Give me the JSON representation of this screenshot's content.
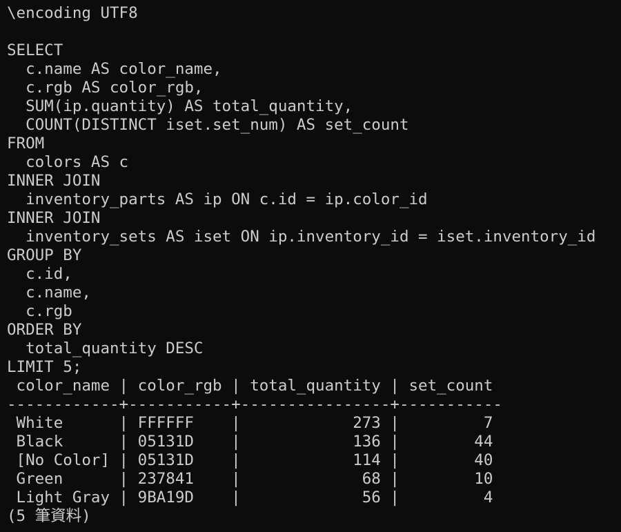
{
  "terminal": {
    "lines": [
      "\\encoding UTF8",
      "",
      "SELECT",
      "  c.name AS color_name,",
      "  c.rgb AS color_rgb,",
      "  SUM(ip.quantity) AS total_quantity,",
      "  COUNT(DISTINCT iset.set_num) AS set_count",
      "FROM",
      "  colors AS c",
      "INNER JOIN",
      "  inventory_parts AS ip ON c.id = ip.color_id",
      "INNER JOIN",
      "  inventory_sets AS iset ON ip.inventory_id = iset.inventory_id",
      "GROUP BY",
      "  c.id,",
      "  c.name,",
      "  c.rgb",
      "ORDER BY",
      "  total_quantity DESC",
      "LIMIT 5;",
      " color_name | color_rgb | total_quantity | set_count",
      "------------+-----------+----------------+-----------",
      " White      | FFFFFF    |            273 |         7",
      " Black      | 05131D    |            136 |        44",
      " [No Color] | 05131D    |            114 |        40",
      " Green      | 237841    |             68 |        10",
      " Light Gray | 9BA19D    |             56 |         4",
      "(5 筆資料)"
    ]
  },
  "colors": {
    "background": "#0c0c0c",
    "foreground": "#cccccc"
  }
}
